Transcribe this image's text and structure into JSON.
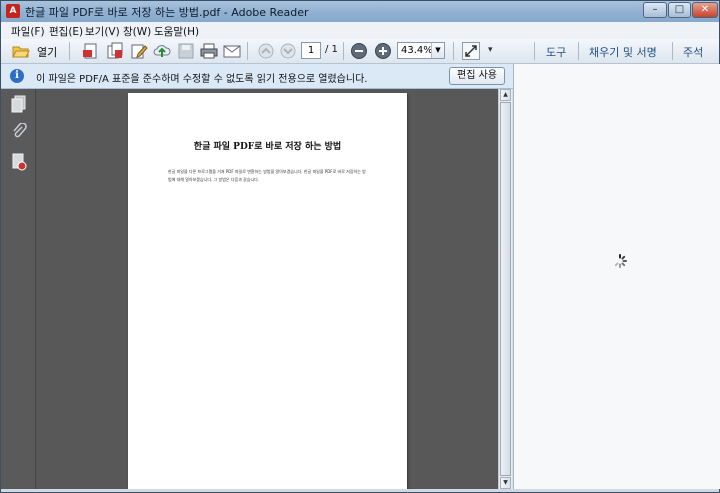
{
  "window": {
    "title": "한글 파일 PDF로 바로 저장 하는 방법.pdf - Adobe Reader",
    "controls": {
      "minimize": "–",
      "maximize": "□",
      "close": "✕"
    }
  },
  "menu": [
    "파일(F)",
    "편집(E)",
    "보기(V)",
    "창(W)",
    "도움말(H)"
  ],
  "toolbar": {
    "open_label": "열기",
    "page_current": "1",
    "page_total": "/ 1",
    "zoom": "43.4%",
    "zoom_dropdown": "▼",
    "more": "▾",
    "right_tabs": [
      "도구",
      "채우기 및 서명",
      "주석"
    ]
  },
  "infobar": {
    "icon": "i",
    "message": "이 파일은 PDF/A 표준을 준수하며 수정할 수 없도록 읽기 전용으로 열렸습니다.",
    "button": "편집 사용"
  },
  "document": {
    "title": "한글 파일 PDF로 바로 저장 하는 방법",
    "body": "한글 파일을 다른 프로그램을 거쳐 PDF 파일로 변환하는 방법을 알아보겠습니다. 한글 파일을 PDF로 바로 저장하는 방법에 대해 알아보겠습니다. 그 방법은 다음과 같습니다."
  },
  "scrollbar": {
    "up": "▲",
    "down": "▼"
  },
  "icons": {
    "app": "adobe-reader-icon",
    "open": "folder-open-icon",
    "pages": "pages-icon",
    "attachment": "paperclip-icon",
    "signature": "signature-icon",
    "spinner": "loading-spinner-icon"
  }
}
